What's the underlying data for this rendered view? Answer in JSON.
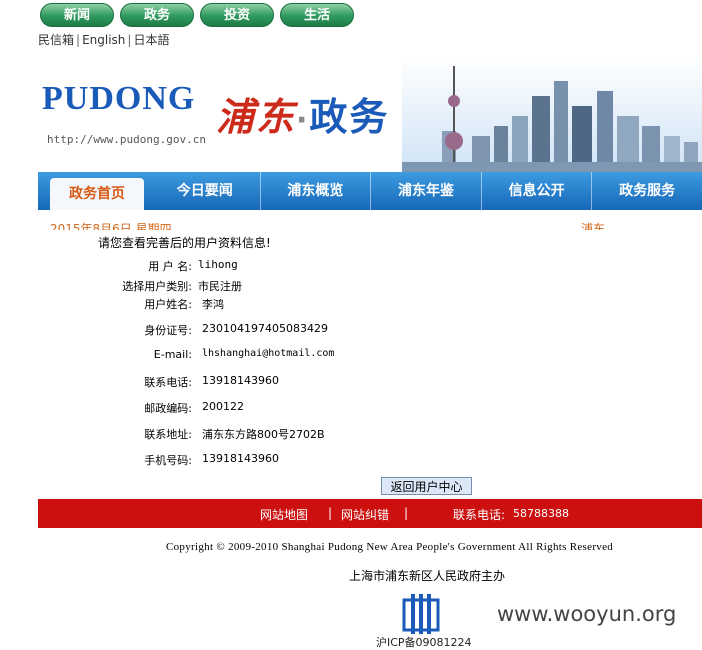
{
  "top_tabs": [
    "新闻",
    "政务",
    "投资",
    "生活"
  ],
  "language_links": [
    "民信箱",
    "English",
    "日本語"
  ],
  "banner": {
    "logo_text": "PUDONG",
    "logo_url": "http://www.pudong.gov.cn",
    "title_left": "浦东",
    "title_dot": "·",
    "title_right": "政务"
  },
  "nav": {
    "items": [
      "政务首页",
      "今日要闻",
      "浦东概览",
      "浦东年鉴",
      "信息公开",
      "政务服务"
    ],
    "active": "政务首页"
  },
  "subbar": {
    "left": "2015年8月6日 星期四",
    "right": "浦东..."
  },
  "profile": {
    "notice": "请您查看完善后的用户资料信息!",
    "fields": [
      {
        "label": "用 户 名:",
        "value": "lihong"
      },
      {
        "label": "选择用户类别:",
        "value": "市民注册"
      },
      {
        "label": "用户姓名:",
        "value": "李鸿"
      },
      {
        "label": "身份证号:",
        "value": "230104197405083429"
      },
      {
        "label": "E-mail:",
        "value": "lhshanghai@hotmail.com"
      },
      {
        "label": "联系电话:",
        "value": "13918143960"
      },
      {
        "label": "邮政编码:",
        "value": "200122"
      },
      {
        "label": "联系地址:",
        "value": "浦东东方路800号2702B"
      },
      {
        "label": "手机号码:",
        "value": "13918143960"
      }
    ],
    "back_button": "返回用户中心"
  },
  "footer": {
    "sitemap": "网站地图",
    "sep": "|",
    "error_report": "网站纠错",
    "phone_label": "联系电话:",
    "phone": "58788388",
    "copyright": "Copyright © 2009-2010 Shanghai Pudong New Area People's Government All Rights Reserved",
    "host": "上海市浦东新区人民政府主办",
    "icp": "沪ICP备09081224"
  },
  "watermark": "www.wooyun.org",
  "colors": {
    "nav_blue": "#1667b8",
    "footer_red": "#cc1010",
    "pill_green": "#2f9a5e"
  }
}
